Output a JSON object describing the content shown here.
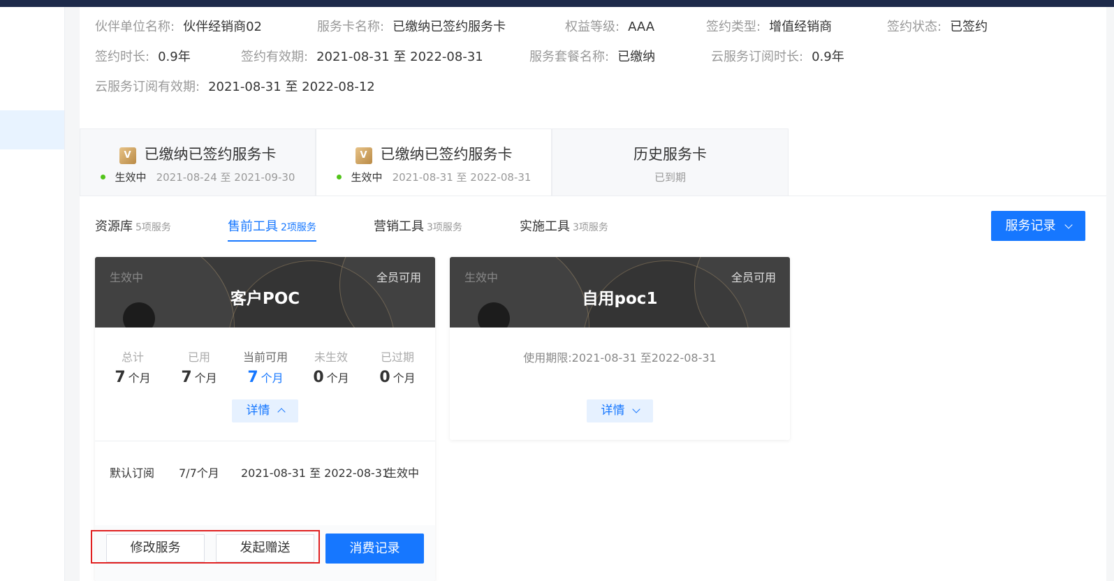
{
  "info": {
    "row1": [
      {
        "key": "伙伴单位名称:",
        "value": "伙伴经销商02"
      },
      {
        "key": "服务卡名称:",
        "value": "已缴纳已签约服务卡"
      },
      {
        "key": "权益等级:",
        "value": "AAA"
      },
      {
        "key": "签约类型:",
        "value": "增值经销商"
      },
      {
        "key": "签约状态:",
        "value": "已签约"
      }
    ],
    "row2": [
      {
        "key": "签约时长:",
        "value": "0.9年"
      },
      {
        "key": "签约有效期:",
        "value": "2021-08-31 至 2022-08-31"
      },
      {
        "key": "服务套餐名称:",
        "value": "已缴纳"
      },
      {
        "key": "云服务订阅时长:",
        "value": "0.9年"
      }
    ],
    "row3": [
      {
        "key": "云服务订阅有效期:",
        "value": "2021-08-31 至 2022-08-12"
      }
    ]
  },
  "card_tabs": [
    {
      "badge": "V",
      "title": "已缴纳已签约服务卡",
      "status": "生效中",
      "period": "2021-08-24 至 2021-09-30"
    },
    {
      "badge": "V",
      "title": "已缴纳已签约服务卡",
      "status": "生效中",
      "period": "2021-08-31 至 2022-08-31"
    },
    {
      "title": "历史服务卡",
      "sub": "已到期"
    }
  ],
  "category_tabs": [
    {
      "name": "资源库",
      "count": "5项服务"
    },
    {
      "name": "售前工具",
      "count": "2项服务"
    },
    {
      "name": "营销工具",
      "count": "3项服务"
    },
    {
      "name": "实施工具",
      "count": "3项服务"
    }
  ],
  "service_record_button": "服务记录",
  "colors": {
    "primary": "#1677ff",
    "success": "#52c41a",
    "highlight": "#e02020"
  },
  "services": [
    {
      "status": "生效中",
      "scope": "全员可用",
      "name": "客户POC",
      "stats": [
        {
          "label": "总计",
          "value": "7",
          "unit": "个月"
        },
        {
          "label": "已用",
          "value": "7",
          "unit": "个月"
        },
        {
          "label": "当前可用",
          "value": "7",
          "unit": "个月"
        },
        {
          "label": "未生效",
          "value": "0",
          "unit": "个月"
        },
        {
          "label": "已过期",
          "value": "0",
          "unit": "个月"
        }
      ],
      "detail_label": "详情",
      "subscription": {
        "name": "默认订阅",
        "usage": "7/7个月",
        "period": "2021-08-31 至 2022-08-31",
        "status": "生效中"
      },
      "actions": {
        "modify": "修改服务",
        "gift": "发起赠送",
        "records": "消费记录"
      }
    },
    {
      "status": "生效中",
      "scope": "全员可用",
      "name": "自用poc1",
      "usage_period": "使用期限:2021-08-31 至2022-08-31",
      "detail_label": "详情"
    }
  ]
}
